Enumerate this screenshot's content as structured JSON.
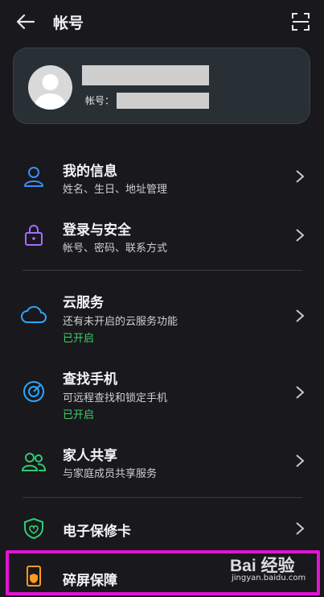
{
  "header": {
    "title": "帐号",
    "back_icon": "back-arrow-icon",
    "scan_icon": "scan-icon"
  },
  "profile": {
    "account_label": "帐号："
  },
  "menu": [
    {
      "title": "我的信息",
      "subtitle": "姓名、生日、地址管理",
      "icon": "person-icon"
    },
    {
      "title": "登录与安全",
      "subtitle": "帐号、密码、联系方式",
      "icon": "lock-icon"
    },
    {
      "title": "云服务",
      "subtitle": "还有未开启的云服务功能",
      "status": "已开启",
      "icon": "cloud-icon"
    },
    {
      "title": "查找手机",
      "subtitle": "可远程查找和锁定手机",
      "status": "已开启",
      "icon": "radar-icon"
    },
    {
      "title": "家人共享",
      "subtitle": "与家庭成员共享服务",
      "icon": "family-icon"
    },
    {
      "title": "电子保修卡",
      "icon": "shield-icon"
    },
    {
      "title": "碎屏保障",
      "icon": "phone-shield-icon"
    }
  ],
  "watermark": {
    "logo": "Bai 经验",
    "url": "jingyan.baidu.com"
  },
  "colors": {
    "background": "#19181d",
    "card": "#283036",
    "status_green": "#3fcf6a",
    "icon_blue": "#3b8cff",
    "icon_purple": "#a46cff",
    "icon_cyan": "#2aa6ff",
    "icon_green": "#2ecc71",
    "icon_orange": "#ff9a1a",
    "highlight": "#e412d6"
  }
}
